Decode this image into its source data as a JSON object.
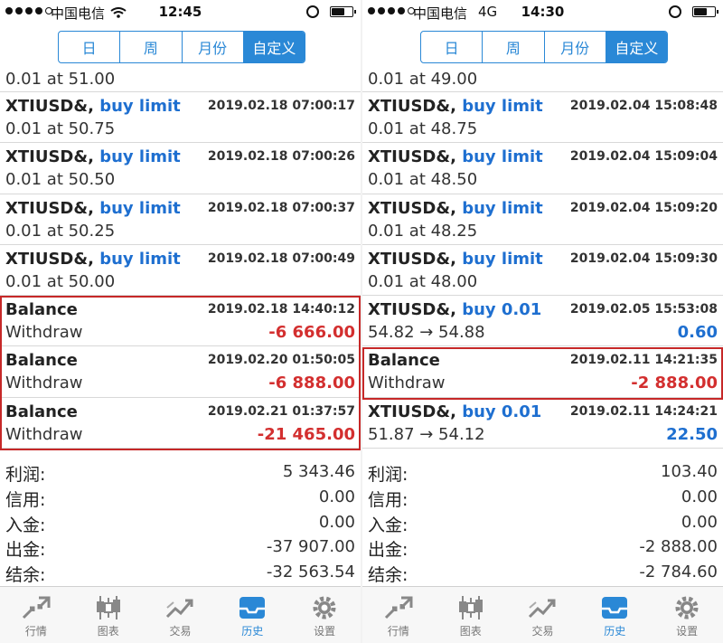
{
  "left": {
    "status": {
      "carrier": "中国电信",
      "network": "",
      "time": "12:45"
    },
    "segments": [
      "日",
      "周",
      "月份",
      "自定义"
    ],
    "active_segment": 3,
    "top_fragment": "0.01 at 51.00",
    "rows": [
      {
        "symbol": "XTIUSD&,",
        "action": "buy limit",
        "datetime": "2019.02.18 07:00:17",
        "sub": "0.01 at 50.75",
        "value": "",
        "value_sign": ""
      },
      {
        "symbol": "XTIUSD&,",
        "action": "buy limit",
        "datetime": "2019.02.18 07:00:26",
        "sub": "0.01 at 50.50",
        "value": "",
        "value_sign": ""
      },
      {
        "symbol": "XTIUSD&,",
        "action": "buy limit",
        "datetime": "2019.02.18 07:00:37",
        "sub": "0.01 at 50.25",
        "value": "",
        "value_sign": ""
      },
      {
        "symbol": "XTIUSD&,",
        "action": "buy limit",
        "datetime": "2019.02.18 07:00:49",
        "sub": "0.01 at 50.00",
        "value": "",
        "value_sign": ""
      },
      {
        "symbol": "Balance",
        "action": "",
        "datetime": "2019.02.18 14:40:12",
        "sub": "Withdraw",
        "value": "-6 666.00",
        "value_sign": "neg"
      },
      {
        "symbol": "Balance",
        "action": "",
        "datetime": "2019.02.20 01:50:05",
        "sub": "Withdraw",
        "value": "-6 888.00",
        "value_sign": "neg"
      },
      {
        "symbol": "Balance",
        "action": "",
        "datetime": "2019.02.21 01:37:57",
        "sub": "Withdraw",
        "value": "-21 465.00",
        "value_sign": "neg"
      }
    ],
    "summary": [
      {
        "label": "利润:",
        "value": "5 343.46"
      },
      {
        "label": "信用:",
        "value": "0.00"
      },
      {
        "label": "入金:",
        "value": "0.00"
      },
      {
        "label": "出金:",
        "value": "-37 907.00"
      },
      {
        "label": "结余:",
        "value": "-32 563.54"
      }
    ]
  },
  "right": {
    "status": {
      "carrier": "中国电信",
      "network": "4G",
      "time": "14:30"
    },
    "segments": [
      "日",
      "周",
      "月份",
      "自定义"
    ],
    "active_segment": 3,
    "top_fragment": "0.01 at 49.00",
    "rows": [
      {
        "symbol": "XTIUSD&,",
        "action": "buy limit",
        "datetime": "2019.02.04 15:08:48",
        "sub": "0.01 at 48.75",
        "value": "",
        "value_sign": ""
      },
      {
        "symbol": "XTIUSD&,",
        "action": "buy limit",
        "datetime": "2019.02.04 15:09:04",
        "sub": "0.01 at 48.50",
        "value": "",
        "value_sign": ""
      },
      {
        "symbol": "XTIUSD&,",
        "action": "buy limit",
        "datetime": "2019.02.04 15:09:20",
        "sub": "0.01 at 48.25",
        "value": "",
        "value_sign": ""
      },
      {
        "symbol": "XTIUSD&,",
        "action": "buy limit",
        "datetime": "2019.02.04 15:09:30",
        "sub": "0.01 at 48.00",
        "value": "",
        "value_sign": ""
      },
      {
        "symbol": "XTIUSD&,",
        "action": "buy 0.01",
        "datetime": "2019.02.05 15:53:08",
        "sub": "54.82 → 54.88",
        "value": "0.60",
        "value_sign": "pos"
      },
      {
        "symbol": "Balance",
        "action": "",
        "datetime": "2019.02.11 14:21:35",
        "sub": "Withdraw",
        "value": "-2 888.00",
        "value_sign": "neg"
      },
      {
        "symbol": "XTIUSD&,",
        "action": "buy 0.01",
        "datetime": "2019.02.11 14:24:21",
        "sub": "51.87 → 54.12",
        "value": "22.50",
        "value_sign": "pos"
      }
    ],
    "summary": [
      {
        "label": "利润:",
        "value": "103.40"
      },
      {
        "label": "信用:",
        "value": "0.00"
      },
      {
        "label": "入金:",
        "value": "0.00"
      },
      {
        "label": "出金:",
        "value": "-2 888.00"
      },
      {
        "label": "结余:",
        "value": "-2 784.60"
      }
    ]
  },
  "tabbar": [
    {
      "label": "行情",
      "icon": "arrows-icon"
    },
    {
      "label": "图表",
      "icon": "candlestick-icon"
    },
    {
      "label": "交易",
      "icon": "trend-icon"
    },
    {
      "label": "历史",
      "icon": "inbox-icon"
    },
    {
      "label": "设置",
      "icon": "gear-icon"
    }
  ],
  "active_tab": 3,
  "colors": {
    "accent": "#2a88d6",
    "negative": "#d32f2f",
    "positive": "#1e6fd0",
    "highlight_box": "#c62828"
  }
}
